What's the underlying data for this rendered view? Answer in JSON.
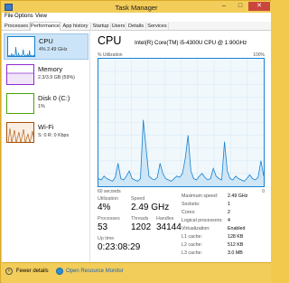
{
  "window": {
    "title": "Task Manager",
    "minimize_glyph": "–",
    "maximize_glyph": "□",
    "close_glyph": "✕",
    "app_icon": "task-manager-icon"
  },
  "menu": [
    "File",
    "Options",
    "View"
  ],
  "tabs": [
    "Processes",
    "Performance",
    "App history",
    "Startup",
    "Users",
    "Details",
    "Services"
  ],
  "active_tab": "Performance",
  "sidebar": {
    "items": [
      {
        "name": "CPU",
        "detail": "4% 2.49 GHz",
        "color": "#1481d1",
        "selected": true
      },
      {
        "name": "Memory",
        "detail": "2.3/3.9 GB (59%)",
        "color": "#8b2bd1",
        "selected": false
      },
      {
        "name": "Disk 0 (C:)",
        "detail": "1%",
        "color": "#4ca20d",
        "selected": false
      },
      {
        "name": "Wi-Fi",
        "detail": "S: 0 R: 0 Kbps",
        "color": "#a74f01",
        "selected": false
      }
    ]
  },
  "cpu": {
    "title": "CPU",
    "model": "Intel(R) Core(TM) i5-4300U CPU @ 1.90GHz",
    "graph_label": "% Utilization",
    "graph_max": "100%",
    "graph_time": "60 seconds",
    "graph_min": "0",
    "utilization_pct": [
      6,
      5,
      8,
      6,
      5,
      4,
      7,
      18,
      6,
      5,
      8,
      12,
      6,
      5,
      4,
      6,
      52,
      30,
      8,
      6,
      5,
      7,
      18,
      10,
      6,
      5,
      4,
      6,
      8,
      7,
      10,
      22,
      40,
      12,
      6,
      5,
      8,
      10,
      7,
      5,
      6,
      14,
      8,
      6,
      5,
      35,
      12,
      6,
      5,
      8,
      6,
      5,
      4,
      6,
      9,
      6,
      5,
      7,
      20,
      8
    ]
  },
  "stats": {
    "utilization": {
      "label": "Utilization",
      "value": "4%"
    },
    "speed": {
      "label": "Speed",
      "value": "2.49 GHz"
    },
    "processes": {
      "label": "Processes",
      "value": "53"
    },
    "threads": {
      "label": "Threads",
      "value": "1202"
    },
    "handles": {
      "label": "Handles",
      "value": "34144"
    },
    "uptime": {
      "label": "Up time",
      "value": "0:23:08:29"
    }
  },
  "specs": [
    {
      "label": "Maximum speed:",
      "value": "2.49 GHz"
    },
    {
      "label": "Sockets:",
      "value": "1"
    },
    {
      "label": "Cores:",
      "value": "2"
    },
    {
      "label": "Logical processors:",
      "value": "4"
    },
    {
      "label": "Virtualization:",
      "value": "Enabled"
    },
    {
      "label": "L1 cache:",
      "value": "128 KB"
    },
    {
      "label": "L2 cache:",
      "value": "512 KB"
    },
    {
      "label": "L3 cache:",
      "value": "3.0 MB"
    }
  ],
  "footer": {
    "fewer_details": "Fewer details",
    "open_monitor": "Open Resource Monitor",
    "chevron_glyph": "˄"
  }
}
